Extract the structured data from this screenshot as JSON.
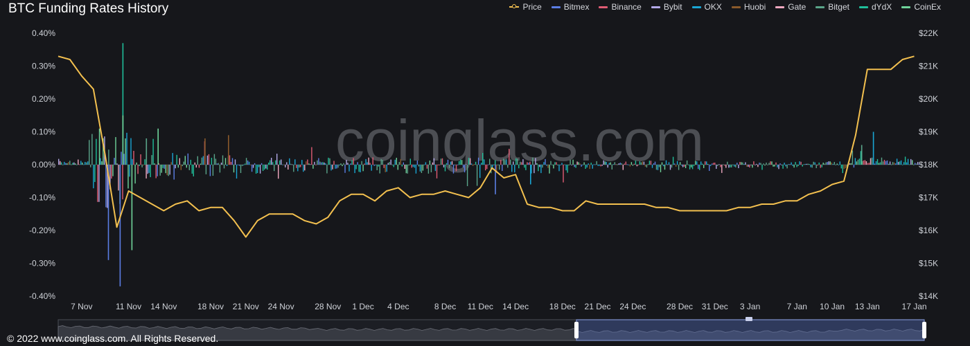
{
  "title": "BTC Funding Rates History",
  "footer": "© 2022 www.coinglass.com. All Rights Reserved.",
  "watermark": "coinglass.com",
  "legend": [
    {
      "label": "Price",
      "color": "#f3c04f",
      "icon": "line-marker"
    },
    {
      "label": "Bitmex",
      "color": "#5b7ee5",
      "icon": "bar"
    },
    {
      "label": "Binance",
      "color": "#e05c74",
      "icon": "bar"
    },
    {
      "label": "Bybit",
      "color": "#b3a9e8",
      "icon": "bar"
    },
    {
      "label": "OKX",
      "color": "#1aa6d4",
      "icon": "bar"
    },
    {
      "label": "Huobi",
      "color": "#8a5a2b",
      "icon": "bar"
    },
    {
      "label": "Gate",
      "color": "#f0a8c0",
      "icon": "bar"
    },
    {
      "label": "Bitget",
      "color": "#5aa58a",
      "icon": "bar"
    },
    {
      "label": "dYdX",
      "color": "#1fbf9a",
      "icon": "bar"
    },
    {
      "label": "CoinEx",
      "color": "#6fd49a",
      "icon": "bar"
    }
  ],
  "chart_data": {
    "type": "bar+line",
    "title": "BTC Funding Rates History",
    "x_tick_labels": [
      "7 Nov",
      "11 Nov",
      "14 Nov",
      "18 Nov",
      "21 Nov",
      "24 Nov",
      "28 Nov",
      "1 Dec",
      "4 Dec",
      "8 Dec",
      "11 Dec",
      "14 Dec",
      "18 Dec",
      "21 Dec",
      "24 Dec",
      "28 Dec",
      "31 Dec",
      "3 Jan",
      "7 Jan",
      "10 Jan",
      "13 Jan",
      "17 Jan"
    ],
    "y_left": {
      "ticks": [
        "0.40%",
        "0.30%",
        "0.20%",
        "0.10%",
        "0.00%",
        "-0.10%",
        "-0.20%",
        "-0.30%",
        "-0.40%"
      ],
      "ylim": [
        -0.4,
        0.4
      ],
      "unit": "%"
    },
    "y_right": {
      "ticks": [
        "$22K",
        "$21K",
        "$20K",
        "$19K",
        "$18K",
        "$17K",
        "$16K",
        "$15K",
        "$14K"
      ],
      "ylim": [
        14000,
        22000
      ]
    },
    "price_series": {
      "name": "Price",
      "x": [
        "2022-11-05",
        "2022-11-06",
        "2022-11-07",
        "2022-11-08",
        "2022-11-09",
        "2022-11-10",
        "2022-11-11",
        "2022-11-12",
        "2022-11-13",
        "2022-11-14",
        "2022-11-15",
        "2022-11-16",
        "2022-11-17",
        "2022-11-18",
        "2022-11-19",
        "2022-11-20",
        "2022-11-21",
        "2022-11-22",
        "2022-11-23",
        "2022-11-24",
        "2022-11-25",
        "2022-11-26",
        "2022-11-27",
        "2022-11-28",
        "2022-11-29",
        "2022-11-30",
        "2022-12-01",
        "2022-12-02",
        "2022-12-03",
        "2022-12-04",
        "2022-12-05",
        "2022-12-06",
        "2022-12-07",
        "2022-12-08",
        "2022-12-09",
        "2022-12-10",
        "2022-12-11",
        "2022-12-12",
        "2022-12-13",
        "2022-12-14",
        "2022-12-15",
        "2022-12-16",
        "2022-12-17",
        "2022-12-18",
        "2022-12-19",
        "2022-12-20",
        "2022-12-21",
        "2022-12-22",
        "2022-12-23",
        "2022-12-24",
        "2022-12-25",
        "2022-12-26",
        "2022-12-27",
        "2022-12-28",
        "2022-12-29",
        "2022-12-30",
        "2022-12-31",
        "2023-01-01",
        "2023-01-02",
        "2023-01-03",
        "2023-01-04",
        "2023-01-05",
        "2023-01-06",
        "2023-01-07",
        "2023-01-08",
        "2023-01-09",
        "2023-01-10",
        "2023-01-11",
        "2023-01-12",
        "2023-01-13",
        "2023-01-14",
        "2023-01-15",
        "2023-01-16",
        "2023-01-17"
      ],
      "values": [
        21300,
        21200,
        20700,
        20300,
        18300,
        16100,
        17200,
        17000,
        16800,
        16600,
        16800,
        16900,
        16600,
        16700,
        16700,
        16300,
        15800,
        16300,
        16500,
        16500,
        16500,
        16300,
        16200,
        16400,
        16900,
        17100,
        17100,
        16900,
        17200,
        17300,
        17000,
        17100,
        17100,
        17200,
        17100,
        17000,
        17300,
        17900,
        17600,
        17700,
        16800,
        16700,
        16700,
        16600,
        16600,
        16900,
        16800,
        16800,
        16800,
        16800,
        16800,
        16700,
        16700,
        16600,
        16600,
        16600,
        16600,
        16600,
        16700,
        16700,
        16800,
        16800,
        16900,
        16900,
        17100,
        17200,
        17400,
        17500,
        18900,
        20900,
        20900,
        20900,
        21200,
        21300
      ]
    },
    "funding_rate_note": "Dense per-exchange funding rate bars (%) clustered around 0.00%, largest spikes around 10–11 Nov: max approx 0.37% (dYdX), min approx -0.37% (Bitmex)."
  }
}
